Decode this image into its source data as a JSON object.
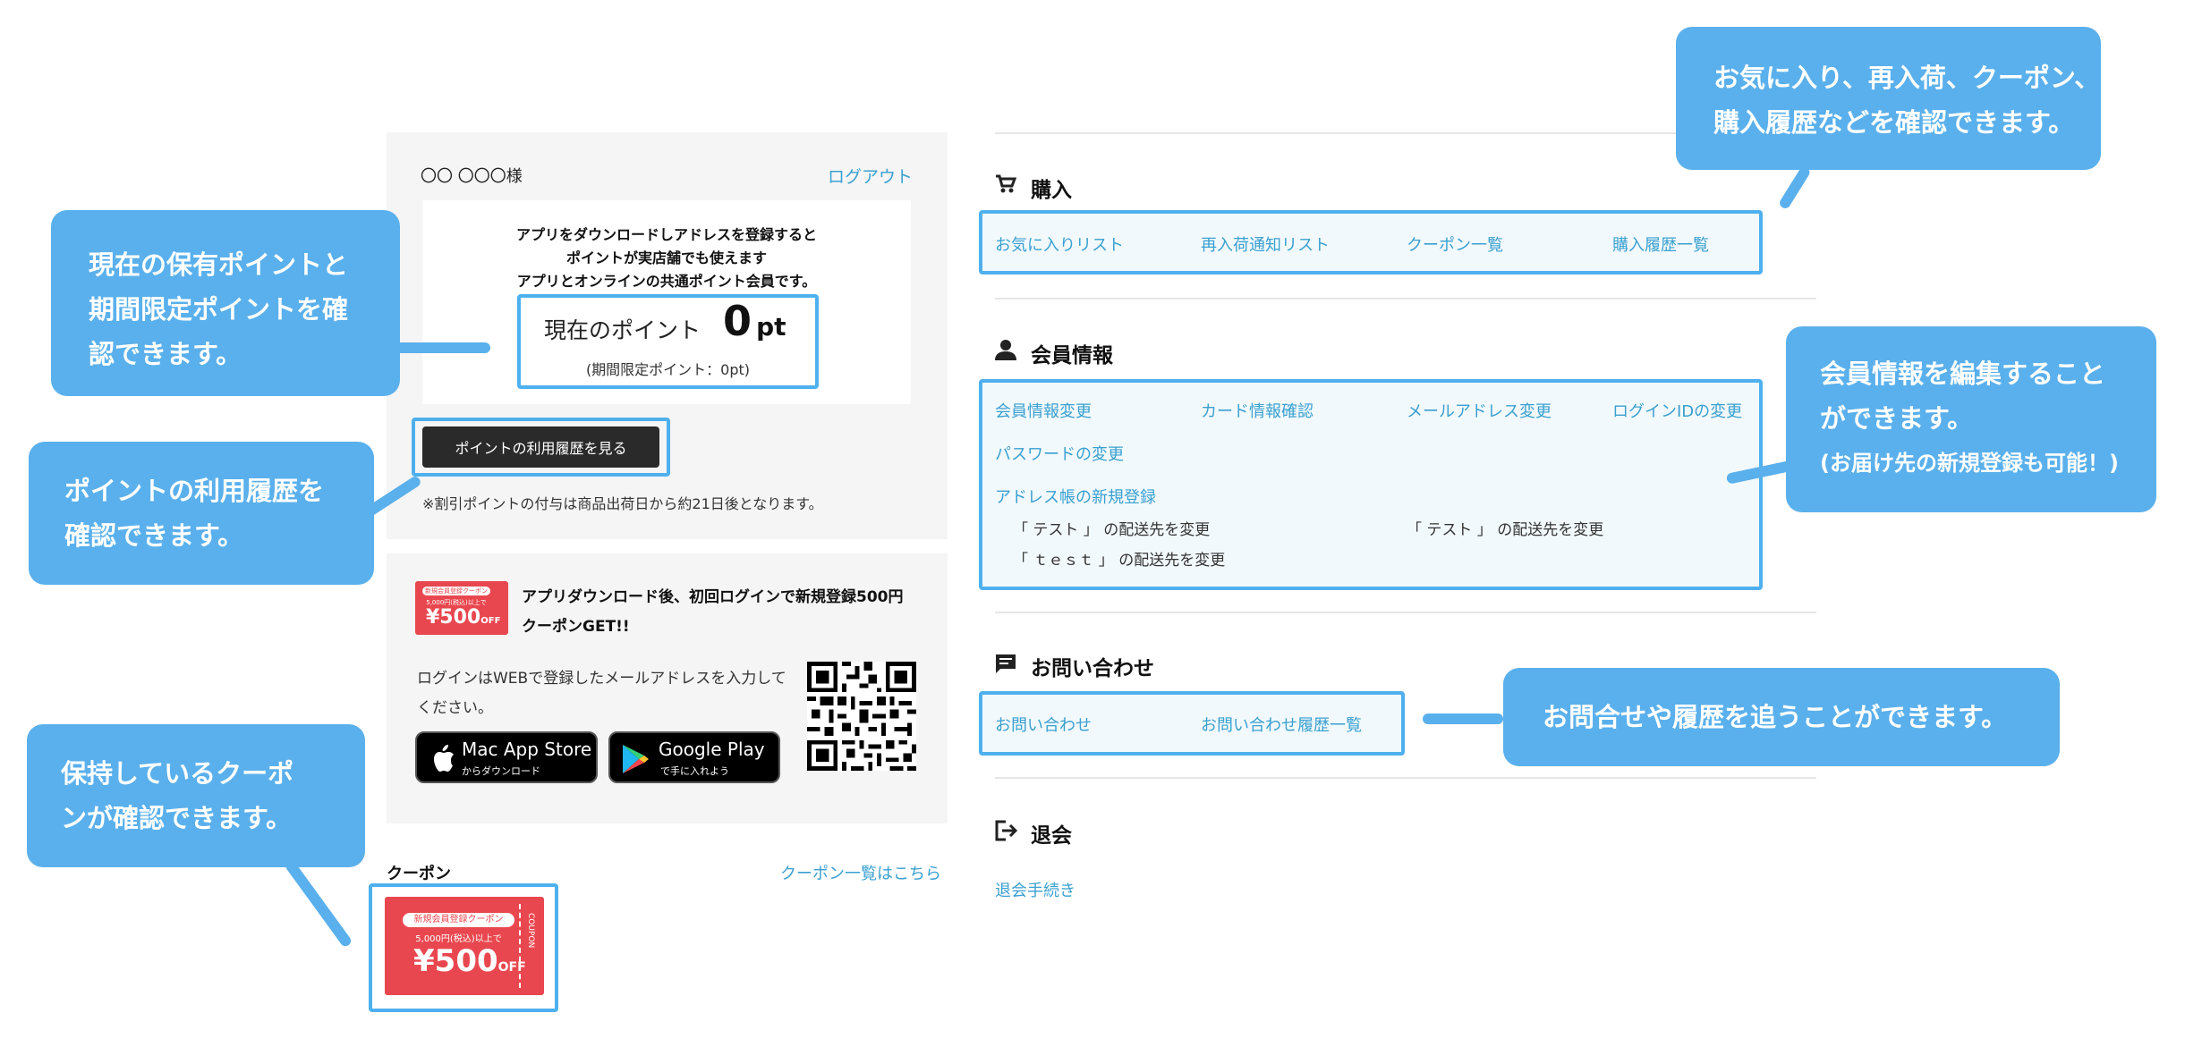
{
  "account": {
    "user_name": "〇〇 〇〇〇様",
    "logout": "ログアウト",
    "promo_line1": "アプリをダウンロードしアドレスを登録すると",
    "promo_line2": "ポイントが実店舗でも使えます",
    "promo_line3": "アプリとオンラインの共通ポイント会員です。",
    "points_label": "現在のポイント",
    "points_value": "0",
    "points_unit": "pt",
    "limited_points": "(期間限定ポイント：0pt)",
    "history_button": "ポイントの利用履歴を見る",
    "note": "※割引ポイントの付与は商品出荷日から約21日後となります。"
  },
  "app_promo": {
    "title_line1": "アプリダウンロード後、初回ログインで新規登録500円",
    "title_line2": "クーポンGET!!",
    "ticket_header": "新規会員登録クーポン",
    "ticket_sub": "5,000円(税込)以上で",
    "ticket_amount": "¥500",
    "ticket_off": "OFF",
    "login_note_line1": "ログインはWEBで登録したメールアドレスを入力して",
    "login_note_line2": "ください。",
    "appstore_main": "Mac App Store",
    "appstore_sub": "からダウンロード",
    "googleplay_main": "Google Play",
    "googleplay_sub": "で手に入れよう"
  },
  "coupon": {
    "title": "クーポン",
    "list_link": "クーポン一覧はこちら",
    "card_header": "新規会員登録クーポン",
    "card_sub": "5,000円(税込)以上で",
    "card_amount": "¥500",
    "card_off": "OFF",
    "card_side": "COUPON"
  },
  "purchase": {
    "title": "購入",
    "icon": "cart-icon",
    "links": [
      "お気に入りリスト",
      "再入荷通知リスト",
      "クーポン一覧",
      "購入履歴一覧"
    ]
  },
  "member": {
    "title": "会員情報",
    "icon": "person-icon",
    "links": [
      "会員情報変更",
      "カード情報確認",
      "メールアドレス変更",
      "ログインIDの変更"
    ],
    "password": "パスワードの変更",
    "address_new": "アドレス帳の新規登録",
    "addresses": [
      "「 テスト 」 の配送先を変更",
      "「 テスト 」 の配送先を変更",
      "「 ｔｅｓｔ 」 の配送先を変更"
    ]
  },
  "inquiry": {
    "title": "お問い合わせ",
    "icon": "chat-icon",
    "links": [
      "お問い合わせ",
      "お問い合わせ履歴一覧"
    ]
  },
  "withdraw": {
    "title": "退会",
    "icon": "logout-icon",
    "link": "退会手続き"
  },
  "callouts": {
    "points": [
      "現在の保有ポイントと",
      "期間限定ポイントを確",
      "認できます。"
    ],
    "history": [
      "ポイントの利用履歴を",
      "確認できます。"
    ],
    "coupons": [
      "保持しているクーポ",
      "ンが確認できます。"
    ],
    "purchase": [
      "お気に入り、再入荷、クーポン、",
      "購入履歴などを確認できます。"
    ],
    "member": [
      "会員情報を編集すること",
      "ができます。",
      "(お届け先の新規登録も可能！)"
    ],
    "inquiry": [
      "お問合せや履歴を追うことができます。"
    ]
  },
  "colors": {
    "accent": "#5ab0ec",
    "link": "#3aa0d0",
    "coupon_red": "#e9474f"
  }
}
